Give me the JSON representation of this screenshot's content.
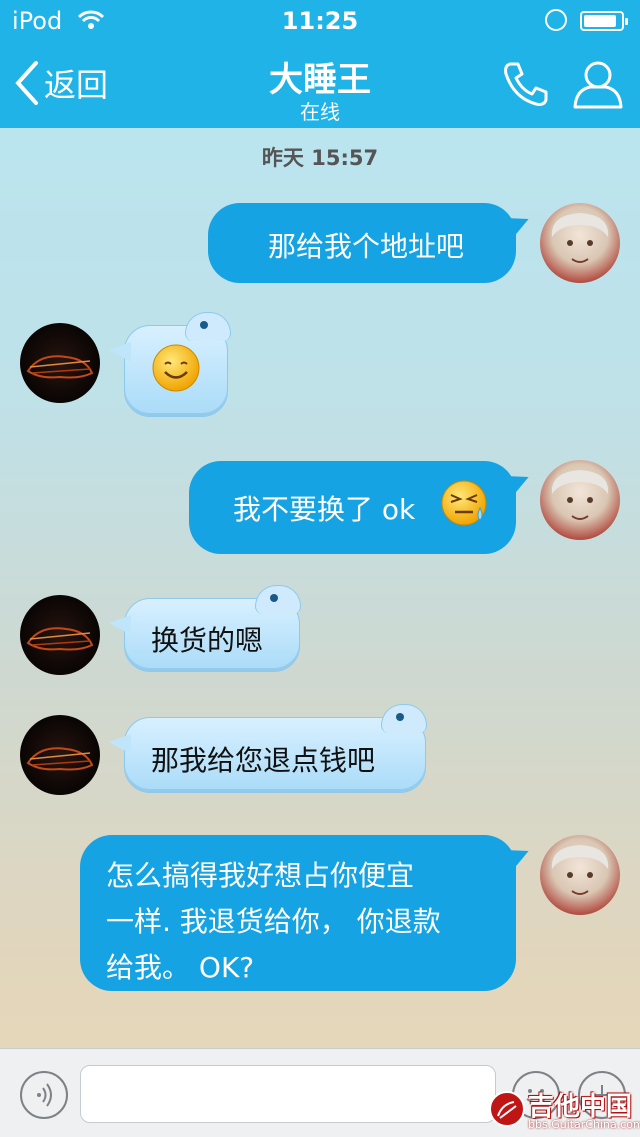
{
  "status_bar": {
    "carrier": "iPod",
    "time": "11:25",
    "battery_level": 0.9
  },
  "header": {
    "back_label": "返回",
    "title": "大睡王",
    "subtitle": "在线"
  },
  "chat": {
    "timestamp": "昨天 15:57",
    "messages": [
      {
        "sender": "me",
        "text": "那给我个地址吧"
      },
      {
        "sender": "them",
        "type": "emoji",
        "emoji": "smile-emoji"
      },
      {
        "sender": "me",
        "text": "我不要换了 ok",
        "emoji": "sweat-emoji"
      },
      {
        "sender": "them",
        "text": "换货的嗯"
      },
      {
        "sender": "them",
        "text": "那我给您退点钱吧"
      },
      {
        "sender": "me",
        "lines": [
          "怎么搞得我好想占你便宜",
          "一样. 我退货给你， 你退款",
          "给我。 OK?"
        ]
      }
    ]
  },
  "watermark": {
    "main": "吉他中国",
    "sub": "bbs.GuitarChina.com"
  },
  "colors": {
    "header": "#1fb3e8",
    "my_bubble": "#15a3e3",
    "their_bubble": "#b9e2fa"
  }
}
